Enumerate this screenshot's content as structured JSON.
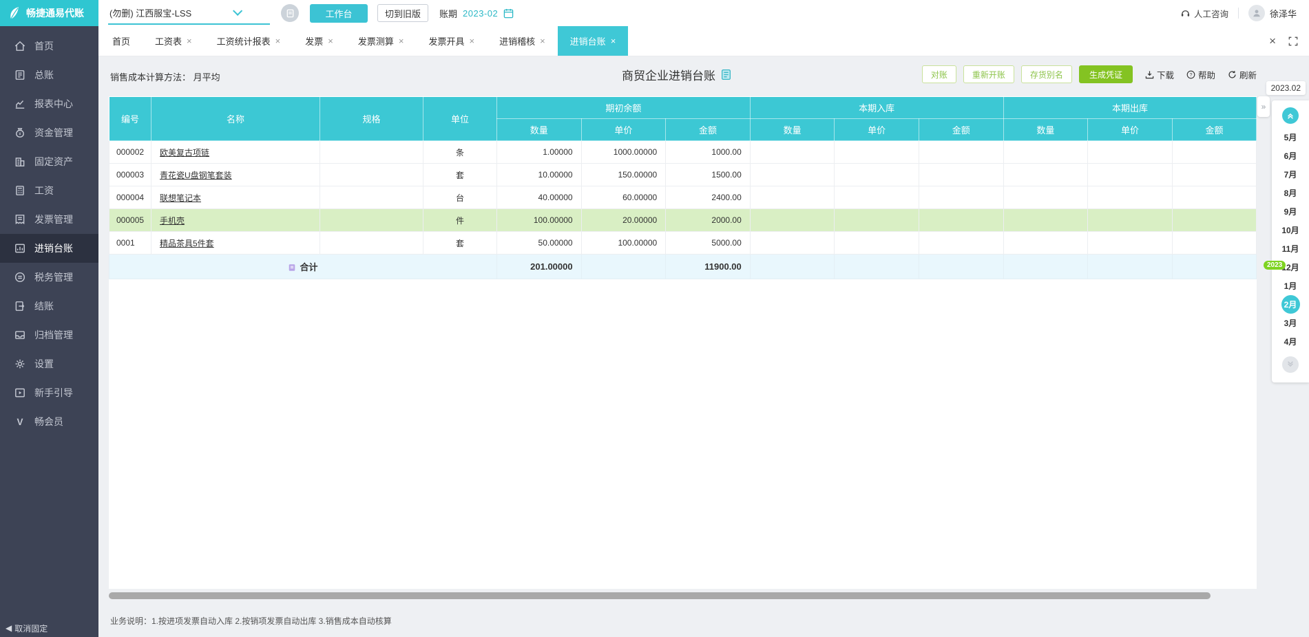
{
  "topbar": {
    "logo_text": "畅捷通易代账",
    "company": "(勿删) 江西服宝-LSS",
    "workbench_btn": "工作台",
    "old_version_btn": "切到旧版",
    "period_label": "账期",
    "period_value": "2023-02",
    "support_label": "人工咨询",
    "username": "徐泽华"
  },
  "sidebar": {
    "items": [
      {
        "key": "home",
        "icon": "home-icon",
        "label": "首页",
        "active": false
      },
      {
        "key": "general-ledger",
        "icon": "ledger-icon",
        "label": "总账",
        "active": false
      },
      {
        "key": "report-center",
        "icon": "report-icon",
        "label": "报表中心",
        "active": false
      },
      {
        "key": "funds",
        "icon": "funds-icon",
        "label": "资金管理",
        "active": false
      },
      {
        "key": "fixed-assets",
        "icon": "assets-icon",
        "label": "固定资产",
        "active": false
      },
      {
        "key": "salary",
        "icon": "salary-icon",
        "label": "工资",
        "active": false
      },
      {
        "key": "invoice",
        "icon": "invoice-icon",
        "label": "发票管理",
        "active": false
      },
      {
        "key": "inventory-ledger",
        "icon": "inventory-icon",
        "label": "进销台账",
        "active": true
      },
      {
        "key": "tax",
        "icon": "tax-icon",
        "label": "税务管理",
        "active": false
      },
      {
        "key": "closing",
        "icon": "closing-icon",
        "label": "结账",
        "active": false
      },
      {
        "key": "archive",
        "icon": "archive-icon",
        "label": "归档管理",
        "active": false
      },
      {
        "key": "settings",
        "icon": "gear-icon",
        "label": "设置",
        "active": false
      },
      {
        "key": "guide",
        "icon": "guide-icon",
        "label": "新手引导",
        "active": false
      },
      {
        "key": "member",
        "icon": "member-icon",
        "label": "畅会员",
        "active": false
      }
    ],
    "unpin_label": "取消固定"
  },
  "tabs": [
    {
      "key": "home",
      "label": "首页",
      "closable": false,
      "active": false
    },
    {
      "key": "salary-sheet",
      "label": "工资表",
      "closable": true,
      "active": false
    },
    {
      "key": "salary-report",
      "label": "工资统计报表",
      "closable": true,
      "active": false
    },
    {
      "key": "invoice",
      "label": "发票",
      "closable": true,
      "active": false
    },
    {
      "key": "invoice-calc",
      "label": "发票测算",
      "closable": true,
      "active": false
    },
    {
      "key": "invoice-issue",
      "label": "发票开具",
      "closable": true,
      "active": false
    },
    {
      "key": "purchase-sale-audit",
      "label": "进销稽核",
      "closable": true,
      "active": false
    },
    {
      "key": "purchase-sale-ledger",
      "label": "进销台账",
      "closable": true,
      "active": true
    }
  ],
  "toolbar": {
    "cost_method": "销售成本计算方法：  月平均",
    "title": "商贸企业进销台账",
    "buttons": [
      "对账",
      "重新开账",
      "存货别名"
    ],
    "primary_button": "生成凭证",
    "download_label": "下载",
    "help_label": "帮助",
    "refresh_label": "刷新"
  },
  "table": {
    "columns": [
      "编号",
      "名称",
      "规格",
      "单位"
    ],
    "groups": [
      {
        "label": "期初余额",
        "sub": [
          "数量",
          "单价",
          "金额"
        ]
      },
      {
        "label": "本期入库",
        "sub": [
          "数量",
          "单价",
          "金额"
        ]
      },
      {
        "label": "本期出库",
        "sub": [
          "数量",
          "单价",
          "金额"
        ]
      }
    ],
    "rows": [
      {
        "code": "000002",
        "name": "欧美复古项链",
        "spec": "",
        "unit": "条",
        "begin": [
          "1.00000",
          "1000.00000",
          "1000.00"
        ],
        "inbound": [
          "",
          "",
          ""
        ],
        "outbound": [
          "",
          "",
          ""
        ],
        "highlight": false
      },
      {
        "code": "000003",
        "name": "青花瓷U盘钢笔套装",
        "spec": "",
        "unit": "套",
        "begin": [
          "10.00000",
          "150.00000",
          "1500.00"
        ],
        "inbound": [
          "",
          "",
          ""
        ],
        "outbound": [
          "",
          "",
          ""
        ],
        "highlight": false
      },
      {
        "code": "000004",
        "name": "联想笔记本",
        "spec": "",
        "unit": "台",
        "begin": [
          "40.00000",
          "60.00000",
          "2400.00"
        ],
        "inbound": [
          "",
          "",
          ""
        ],
        "outbound": [
          "",
          "",
          ""
        ],
        "highlight": false
      },
      {
        "code": "000005",
        "name": "手机壳",
        "spec": "",
        "unit": "件",
        "begin": [
          "100.00000",
          "20.00000",
          "2000.00"
        ],
        "inbound": [
          "",
          "",
          ""
        ],
        "outbound": [
          "",
          "",
          ""
        ],
        "highlight": true
      },
      {
        "code": "0001",
        "name": "精品茶具5件套",
        "spec": "",
        "unit": "套",
        "begin": [
          "50.00000",
          "100.00000",
          "5000.00"
        ],
        "inbound": [
          "",
          "",
          ""
        ],
        "outbound": [
          "",
          "",
          ""
        ],
        "highlight": false
      }
    ],
    "total": {
      "label": "合计",
      "qty": "201.00000",
      "amount": "11900.00"
    }
  },
  "month_panel": {
    "period": "2023.02",
    "year_badge": "2023",
    "months": [
      "5月",
      "6月",
      "7月",
      "8月",
      "9月",
      "10月",
      "11月",
      "12月",
      "1月",
      "2月",
      "3月",
      "4月"
    ],
    "selected": "2月"
  },
  "footer": {
    "note": "业务说明：1.按进项发票自动入库   2.按销项发票自动出库   3.销售成本自动核算"
  },
  "colors": {
    "accent_teal": "#3cc8d4",
    "sidebar_bg": "#3d4355",
    "primary_green": "#84c322",
    "highlight_row": "#d9efc4",
    "total_row_bg": "#e9f7fd",
    "year_badge_green": "#7ed321"
  }
}
